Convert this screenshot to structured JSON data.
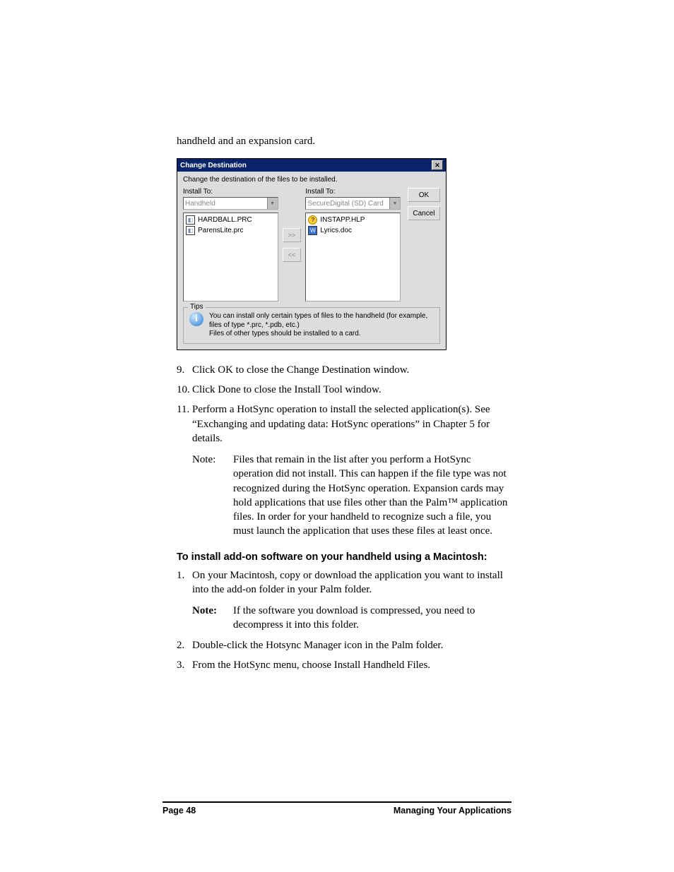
{
  "intro_paragraph": "handheld and an expansion card.",
  "dialog": {
    "title": "Change Destination",
    "caption": "Change the destination of the files to be installed.",
    "left_label": "Install To:",
    "left_combo": "Handheld",
    "left_item1": "HARDBALL.PRC",
    "left_item2": "ParensLite.prc",
    "right_label": "Install To:",
    "right_combo": "SecureDigital (SD) Card",
    "right_item1": "INSTAPP.HLP",
    "right_item2": "Lyrics.doc",
    "move_right": ">>",
    "move_left": "<<",
    "ok": "OK",
    "cancel": "Cancel",
    "tips_legend": "Tips",
    "tips_line1": "You can install only certain types of files to the handheld (for example, files of type *.prc, *.pdb, etc.)",
    "tips_line2": "Files of other types should be installed to a card."
  },
  "step9_num": "9.",
  "step9": "Click OK to close the Change Destination window.",
  "step10_num": "10.",
  "step10": "Click Done to close the Install Tool window.",
  "step11_num": "11.",
  "step11": "Perform a HotSync operation to install the selected application(s). See “Exchanging and updating data: HotSync operations” in Chapter 5 for details.",
  "note1_label": "Note:",
  "note1_text": "Files that remain in the list after you perform a HotSync operation did not install. This can happen if the file type was not recognized during the HotSync operation. Expansion cards may hold applications that use files other than the Palm™ application files. In order for your handheld to recognize such a file, you must launch the application that uses these files at least once.",
  "subheading": "To install add-on software on your handheld using a Macintosh:",
  "m1_num": "1.",
  "m1": "On your Macintosh, copy or download the application you want to install into the add-on folder in your Palm folder.",
  "m1_note_label": "Note:",
  "m1_note_text": "If the software you download is compressed, you need to decompress it into this folder.",
  "m2_num": "2.",
  "m2": "Double-click the Hotsync Manager icon in the Palm folder.",
  "m3_num": "3.",
  "m3": "From the HotSync menu, choose Install Handheld Files.",
  "footer_left": "Page 48",
  "footer_right": "Managing Your Applications"
}
